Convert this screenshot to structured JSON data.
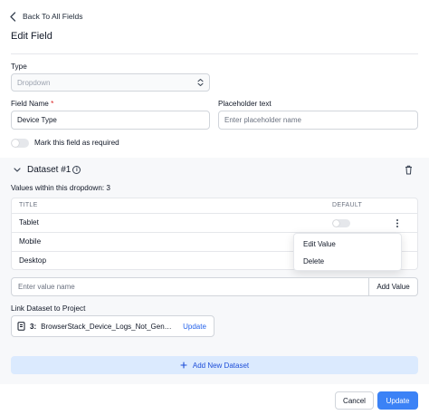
{
  "header": {
    "back_label": "Back To All Fields",
    "title": "Edit Field"
  },
  "form": {
    "type_label": "Type",
    "type_value": "Dropdown",
    "field_name_label": "Field Name",
    "field_name_required_marker": "*",
    "field_name_value": "Device Type",
    "placeholder_label": "Placeholder text",
    "placeholder_placeholder": "Enter placeholder name",
    "required_toggle_label": "Mark this field as required",
    "required_toggle_on": false
  },
  "dataset": {
    "title": "Dataset #1",
    "info_glyph": "i",
    "values_count_text": "Values within this dropdown: 3",
    "columns": {
      "title": "TITLE",
      "default": "DEFAULT"
    },
    "rows": [
      {
        "title": "Tablet",
        "default": false
      },
      {
        "title": "Mobile"
      },
      {
        "title": "Desktop"
      }
    ],
    "row_menu": {
      "edit": "Edit Value",
      "delete": "Delete"
    },
    "value_input_placeholder": "Enter value name",
    "add_value_label": "Add Value",
    "link_label": "Link Dataset to Project",
    "linked_project": {
      "id": "3:",
      "name": "BrowserStack_Device_Logs_Not_Generated",
      "action": "Update"
    }
  },
  "add_dataset_label": "Add New Dataset",
  "footer": {
    "cancel_label": "Cancel",
    "update_label": "Update"
  },
  "colors": {
    "accent": "#3b82f6",
    "link": "#2563eb",
    "add_dataset_bg": "#dbeafe",
    "required": "#dc2626"
  }
}
